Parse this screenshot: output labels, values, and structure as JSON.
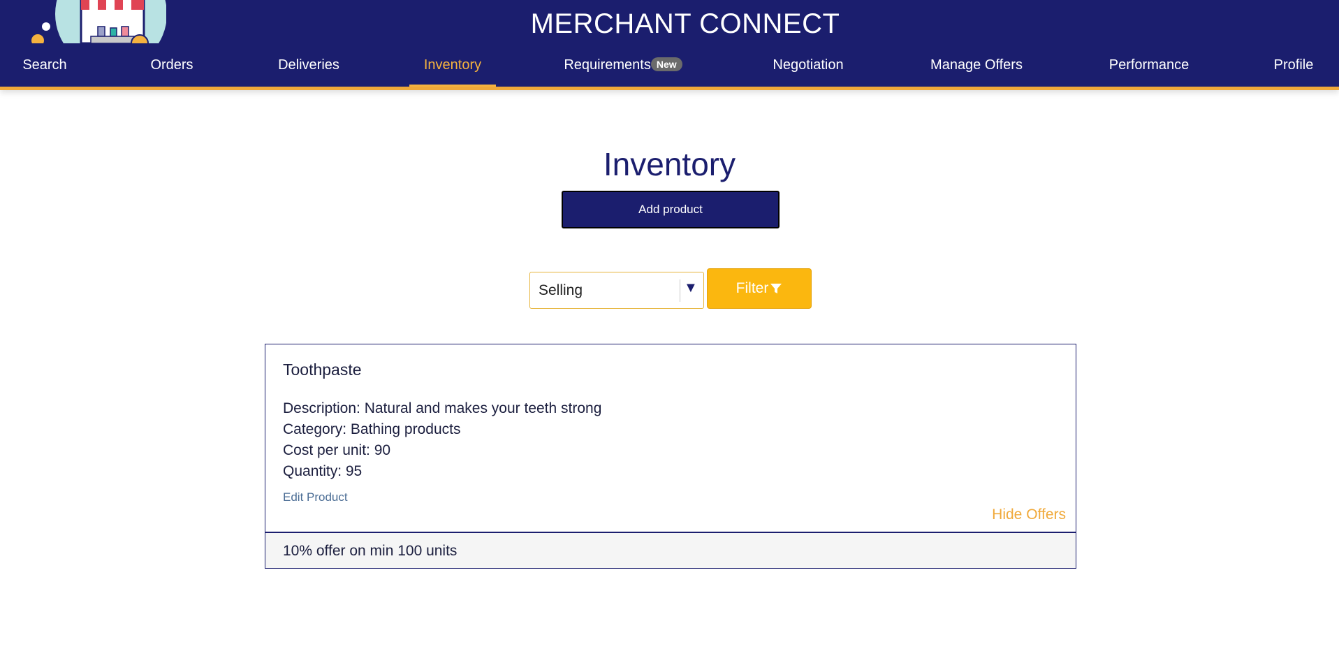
{
  "app": {
    "title": "MERCHANT CONNECT"
  },
  "nav": {
    "items": [
      {
        "label": "Search"
      },
      {
        "label": "Orders"
      },
      {
        "label": "Deliveries"
      },
      {
        "label": "Inventory",
        "active": true
      },
      {
        "label": "Requirements",
        "badge": "New"
      },
      {
        "label": "Negotiation"
      },
      {
        "label": "Manage Offers"
      },
      {
        "label": "Performance"
      },
      {
        "label": "Profile"
      }
    ]
  },
  "page": {
    "title": "Inventory",
    "add_button": "Add product"
  },
  "filter": {
    "selected": "Selling",
    "button_label": "Filter",
    "icon": "funnel-icon"
  },
  "product": {
    "name": "Toothpaste",
    "description": "Description: Natural and makes your teeth strong",
    "category": "Category: Bathing products",
    "cost": "Cost per unit: 90",
    "quantity": "Quantity: 95",
    "edit_label": "Edit Product",
    "hide_offers_label": "Hide Offers",
    "offers": [
      "10% offer on min 100 units"
    ]
  },
  "colors": {
    "primary": "#1b1e6e",
    "accent": "#f0a93a",
    "filter": "#fbb70f"
  }
}
